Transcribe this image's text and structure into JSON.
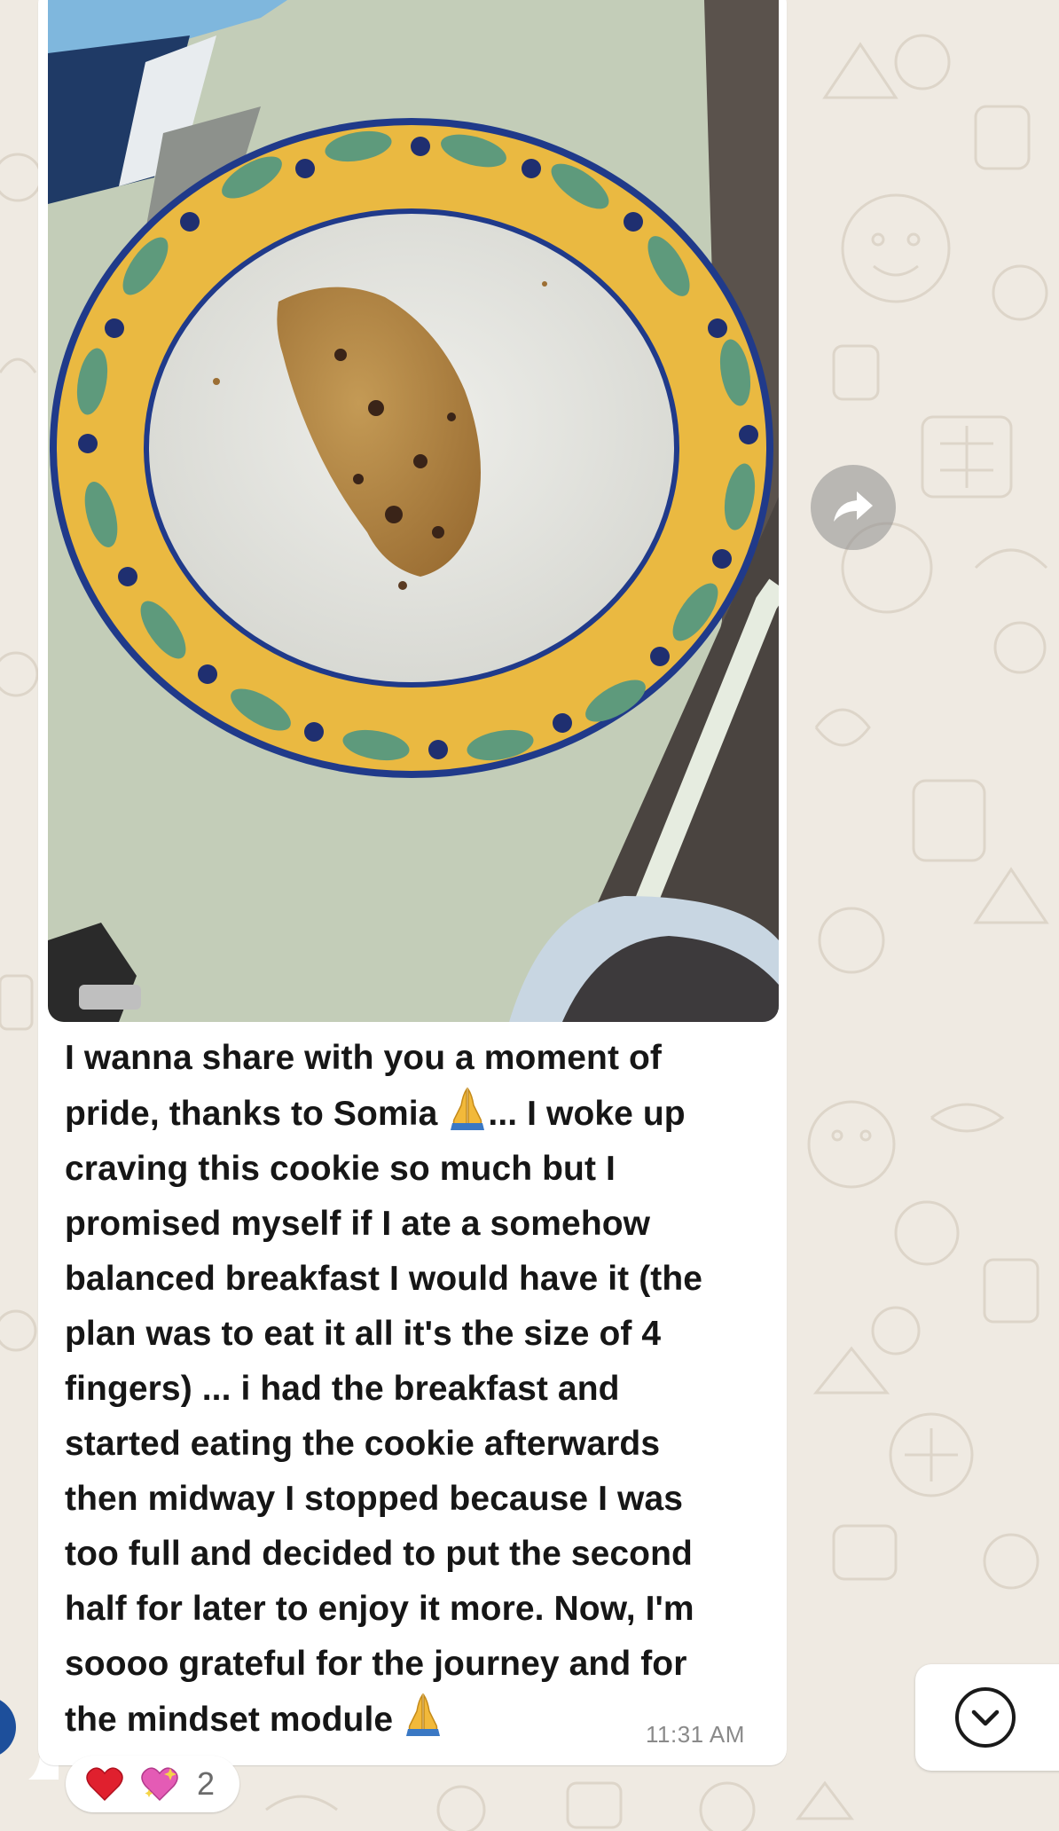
{
  "message": {
    "lines": [
      "I wanna share with you a moment of",
      "pride, thanks to Somia",
      "... I woke up",
      "craving this cookie so much but I",
      "promised myself if I ate a somehow",
      "balanced breakfast I would have it (the",
      "plan was to eat it all it's the size of 4",
      "fingers) ... i had the breakfast and",
      "started eating the cookie afterwards",
      "then midway I stopped because I was",
      "too full and decided to put the second",
      "half for later to enjoy it more. Now, I'm",
      "soooo grateful for the journey and for",
      "the mindset module"
    ],
    "timestamp": "11:31 AM"
  },
  "reactions": {
    "emojis": [
      "red-heart",
      "sparkling-heart"
    ],
    "count": "2"
  },
  "icons": {
    "forward": "forward-arrow-icon",
    "scroll_down": "chevron-down-circle-icon",
    "praying_hands": "praying-hands-emoji"
  },
  "colors": {
    "chat_background": "#efeae2",
    "bubble": "#ffffff",
    "text": "#161616",
    "timestamp": "#8a8a8a"
  }
}
